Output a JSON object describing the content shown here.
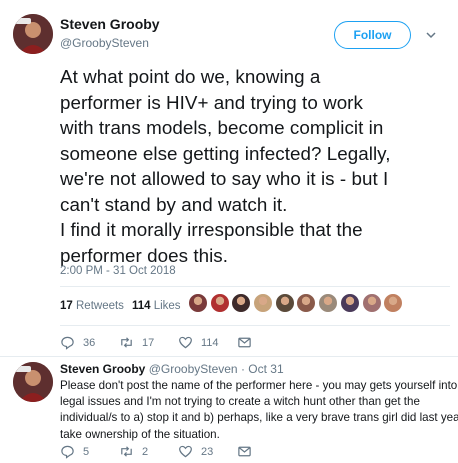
{
  "main_tweet": {
    "author_name": "Steven Grooby",
    "author_handle": "@GroobySteven",
    "follow_label": "Follow",
    "body_lines": [
      "At what point do we, knowing a",
      "performer is HIV+ and trying to work",
      "with trans models, become complicit in",
      "someone else getting infected? Legally,",
      "we're not allowed to say who it is - but I",
      "can't stand by and watch it.",
      "I find it morally irresponsible that the",
      "performer does this."
    ],
    "timestamp": "2:00 PM - 31 Oct 2018",
    "retweets_count": "17",
    "retweets_label": "Retweets",
    "likes_count": "114",
    "likes_label": "Likes",
    "liker_avatar_colors": [
      "#7a3a3a",
      "#b03030",
      "#3d2a2a",
      "#c7a37a",
      "#5a4a3a",
      "#8a5a4a",
      "#9a8a7a",
      "#4a3a5a",
      "#a07070",
      "#c08060"
    ],
    "actions": {
      "reply_count": "36",
      "retweet_count": "17",
      "like_count": "114"
    }
  },
  "reply_tweet": {
    "author_name": "Steven Grooby",
    "author_handle": "@GroobySteven",
    "date": "· Oct 31",
    "body_lines": [
      "Please don't post the name of the performer here - you may gets yourself into",
      "legal issues and I'm not trying to create a witch hunt other than get the",
      "individual/s to a) stop it and b) perhaps, like a very brave trans girl did last year,",
      "take ownership of the situation."
    ],
    "actions": {
      "reply_count": "5",
      "retweet_count": "2",
      "like_count": "23"
    }
  },
  "colors": {
    "accent": "#1da1f2",
    "muted": "#657786",
    "text": "#14171a",
    "divider": "#e6ecf0"
  }
}
